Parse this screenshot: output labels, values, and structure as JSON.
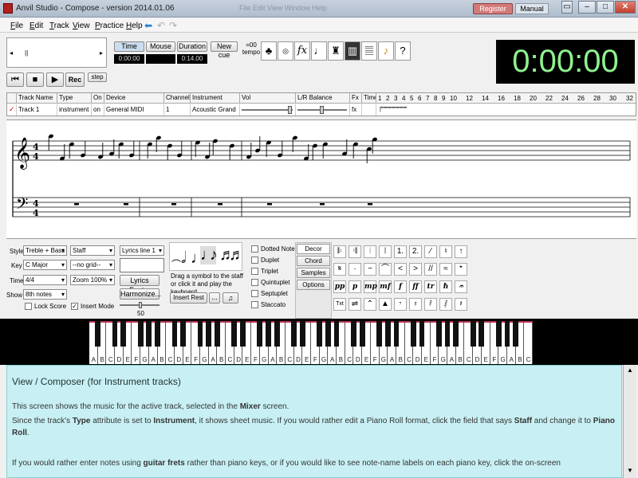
{
  "window": {
    "title": "Anvil Studio - Compose - version 2014.01.06",
    "ghost_menu": "File  Edit  View  Window  Help",
    "register_label": "Register",
    "manual_label": "Manual",
    "min_icon": "minimize-icon",
    "max_icon": "maximize-icon",
    "close_icon": "close-icon",
    "sys_icon": "system-menu-icon"
  },
  "menu": {
    "items": [
      "File",
      "Edit",
      "Track",
      "View",
      "Practice",
      "Help"
    ]
  },
  "transport": {
    "position_label": "||",
    "record_label": "Rec",
    "step_label": "step",
    "time_label": "Time",
    "mouse_label": "Mouse",
    "duration_label": "Duration",
    "newcue_label": "New cue",
    "time_value": "0:00:00",
    "mouse_value": "",
    "duration_value": "0:14.00",
    "tempo_value": "=00",
    "tempo_label": "tempo",
    "clock": "0:00:00"
  },
  "track_table": {
    "headers": [
      "Track Name",
      "Type",
      "On",
      "Device",
      "Channel",
      "Instrument",
      "Vol",
      "L/R Balance",
      "Fx",
      "Time"
    ],
    "bar_numbers": [
      "1",
      "2",
      "3",
      "4",
      "5",
      "6",
      "7",
      "8",
      "9",
      "10",
      "12",
      "14",
      "16",
      "18",
      "20",
      "22",
      "24",
      "26",
      "28",
      "30",
      "32"
    ],
    "row": {
      "name": "Track 1",
      "type": "instrument",
      "on": "on",
      "device": "General MIDI",
      "channel": "1",
      "instrument": "Acoustic Grand",
      "fx": "fx"
    }
  },
  "composer": {
    "style_label": "Style",
    "style_value": "Treble + Bass",
    "view_value": "Staff",
    "key_label": "Key",
    "key_value": "C Major",
    "grid_value": "--no grid--",
    "time_label": "Time",
    "time_value": "4/4",
    "zoom_value": "Zoom 100%",
    "show_label": "Show",
    "show_value": "8th notes",
    "lyric_value": "Lyrics line 1",
    "lyrics_font_label": "Lyrics Font...",
    "harmonize_label": "Harmonize...",
    "slider_value": "50",
    "lock_score_label": "Lock Score",
    "insert_mode_label": "Insert Mode",
    "drag_hint": "Drag a symbol to the staff or click it and play the keyboard",
    "insert_rest_label": "Insert Rest",
    "ellipsis_label": "...",
    "checks": [
      "Dotted Note",
      "Duplet",
      "Triplet",
      "Quintuplet",
      "Septuplet",
      "Staccato"
    ],
    "tabs": [
      "Decor",
      "Chord",
      "Samples",
      "Options"
    ]
  },
  "keyboard": {
    "white_notes": [
      "A",
      "B",
      "C",
      "D",
      "E",
      "F",
      "G",
      "A",
      "B",
      "C",
      "D",
      "E",
      "F",
      "G",
      "A",
      "B",
      "C",
      "D",
      "E",
      "F",
      "G",
      "A",
      "B",
      "C",
      "D",
      "E",
      "F",
      "G",
      "A",
      "B",
      "C",
      "D",
      "E",
      "F",
      "G",
      "A",
      "B",
      "C",
      "D",
      "E",
      "F",
      "G",
      "A",
      "B",
      "C",
      "D",
      "E",
      "F",
      "G",
      "A",
      "B",
      "C"
    ]
  },
  "help": {
    "heading": "View / Composer (for Instrument tracks)",
    "p1_a": "This screen shows the music for the active track, selected in the ",
    "p1_b": "Mixer",
    "p1_c": " screen.",
    "p2_a": "Since the track's ",
    "p2_b": "Type",
    "p2_c": " attribute is set to ",
    "p2_d": "Instrument",
    "p2_e": ", it shows sheet music. If you would rather edit a Piano Roll format, click the field that says ",
    "p2_f": "Staff",
    "p2_g": " and change it to ",
    "p2_h": "Piano Roll",
    "p2_i": ".",
    "p3_a": "If you would rather enter notes using ",
    "p3_b": "guitar frets",
    "p3_c": " rather than piano keys, or if you would like to see note-name labels on each piano key, click the on-screen"
  },
  "colors": {
    "clock_bg": "#000000",
    "clock_fg": "#8ef28e",
    "help_bg": "#c8f0f4",
    "register_bg": "#d27a7a"
  }
}
